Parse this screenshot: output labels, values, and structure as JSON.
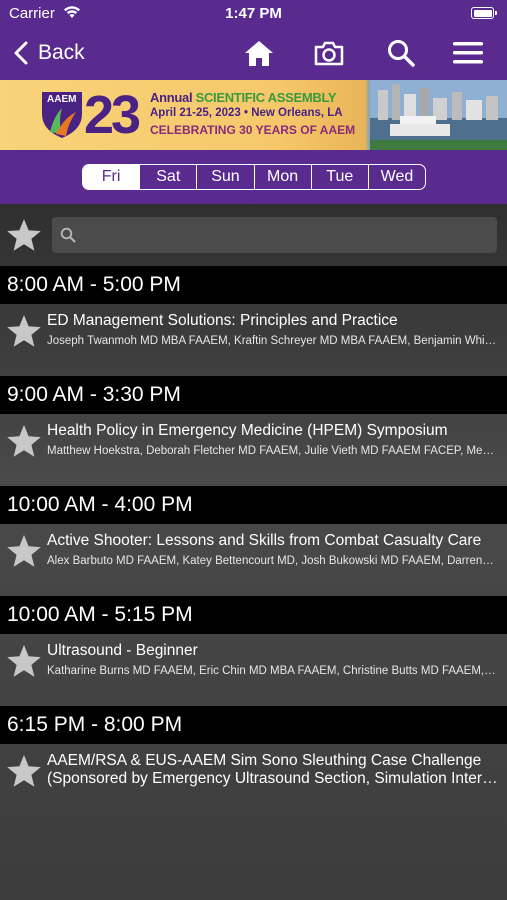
{
  "status_bar": {
    "carrier": "Carrier",
    "time": "1:47 PM"
  },
  "nav": {
    "back_label": "Back",
    "icons": [
      "home-icon",
      "camera-icon",
      "search-icon",
      "menu-icon"
    ]
  },
  "banner": {
    "logo_text": "AAEM",
    "year": "23",
    "line1_plain": "Annual ",
    "line1_accent": "SCIENTIFIC ASSEMBLY",
    "line2": "April 21-25, 2023 • New Orleans, LA",
    "line3": "CELEBRATING 30 YEARS OF AAEM"
  },
  "day_tabs": [
    {
      "label": "Fri",
      "active": true
    },
    {
      "label": "Sat",
      "active": false
    },
    {
      "label": "Sun",
      "active": false
    },
    {
      "label": "Mon",
      "active": false
    },
    {
      "label": "Tue",
      "active": false
    },
    {
      "label": "Wed",
      "active": false
    }
  ],
  "search": {
    "placeholder": "",
    "value": ""
  },
  "sections": [
    {
      "time": "8:00 AM - 5:00 PM",
      "title": "ED Management Solutions: Principles and Practice",
      "subtitle": "Joseph Twanmoh MD MBA FAAEM, Kraftin Schreyer MD MBA FAAEM, Benjamin Whi…"
    },
    {
      "time": "9:00 AM - 3:30 PM",
      "title": "Health Policy in Emergency Medicine (HPEM) Symposium",
      "subtitle": "Matthew Hoekstra, Deborah Fletcher MD FAAEM, Julie Vieth MD FAAEM FACEP, Me…"
    },
    {
      "time": "10:00 AM - 4:00 PM",
      "title": "Active Shooter: Lessons and Skills from Combat Casualty Care",
      "subtitle": "Alex Barbuto MD FAAEM, Katey Bettencourt MD, Josh Bukowski MD FAAEM, Darren…"
    },
    {
      "time": "10:00 AM - 5:15 PM",
      "title": "Ultrasound - Beginner",
      "subtitle": "Katharine Burns MD FAAEM, Eric Chin MD MBA FAAEM, Christine Butts MD FAAEM,…"
    },
    {
      "time": "6:15 PM - 8:00 PM",
      "title": "AAEM/RSA & EUS-AAEM Sim Sono Sleuthing Case Challenge",
      "title2": "(Sponsored by Emergency Ultrasound Section, Simulation Inter…"
    }
  ],
  "colors": {
    "brand_purple": "#5a2b8e",
    "header_black": "#000000"
  }
}
